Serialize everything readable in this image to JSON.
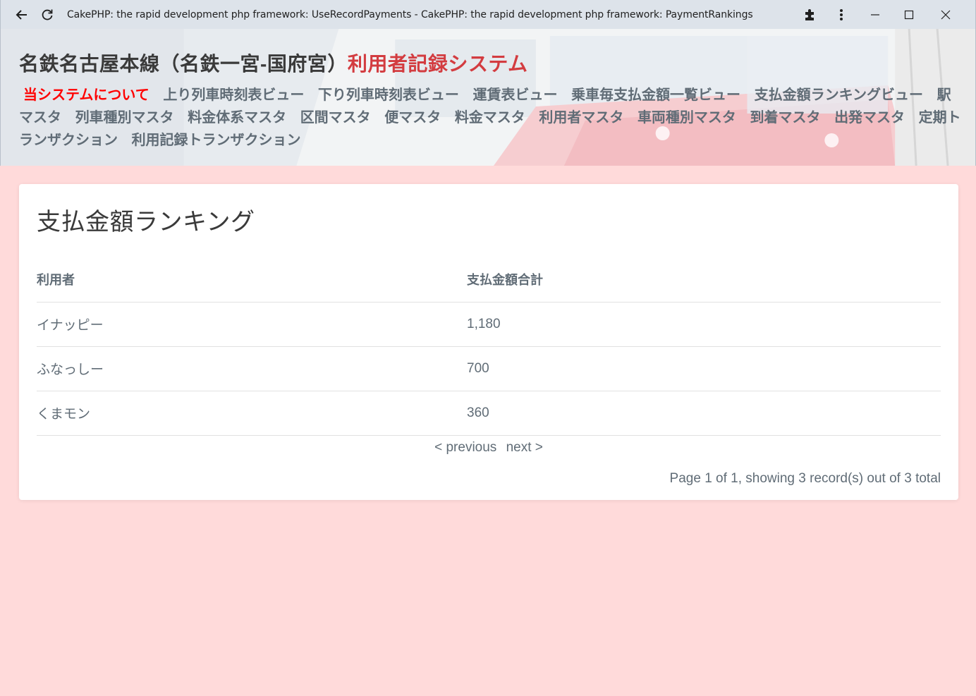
{
  "browser": {
    "tab_title": "CakePHP: the rapid development php framework: UseRecordPayments - CakePHP: the rapid development php framework: PaymentRankings"
  },
  "header": {
    "title_main": "名鉄名古屋本線（名鉄一宮-国府宮）",
    "title_accent": "利用者記録システム",
    "nav": [
      {
        "label": "当システムについて",
        "active": true
      },
      {
        "label": "上り列車時刻表ビュー"
      },
      {
        "label": "下り列車時刻表ビュー"
      },
      {
        "label": "運賃表ビュー"
      },
      {
        "label": "乗車毎支払金額一覧ビュー"
      },
      {
        "label": "支払金額ランキングビュー"
      },
      {
        "label": "駅マスタ"
      },
      {
        "label": "列車種別マスタ"
      },
      {
        "label": "料金体系マスタ"
      },
      {
        "label": "区間マスタ"
      },
      {
        "label": "便マスタ"
      },
      {
        "label": "料金マスタ"
      },
      {
        "label": "利用者マスタ"
      },
      {
        "label": "車両種別マスタ"
      },
      {
        "label": "到着マスタ"
      },
      {
        "label": "出発マスタ"
      },
      {
        "label": "定期トランザクション"
      },
      {
        "label": "利用記録トランザクション"
      }
    ]
  },
  "main": {
    "heading": "支払金額ランキング",
    "columns": [
      "利用者",
      "支払金額合計"
    ],
    "rows": [
      [
        "イナッピー",
        "1,180"
      ],
      [
        "ふなっしー",
        "700"
      ],
      [
        "くまモン",
        "360"
      ]
    ],
    "paginator": {
      "previous": "< previous",
      "next": "next >"
    },
    "counter": "Page 1 of 1, showing 3 record(s) out of 3 total"
  },
  "colors": {
    "page_bg": "#ffdada",
    "accent": "#d33c40",
    "active_nav": "#ff0000",
    "text": "#606c76"
  }
}
